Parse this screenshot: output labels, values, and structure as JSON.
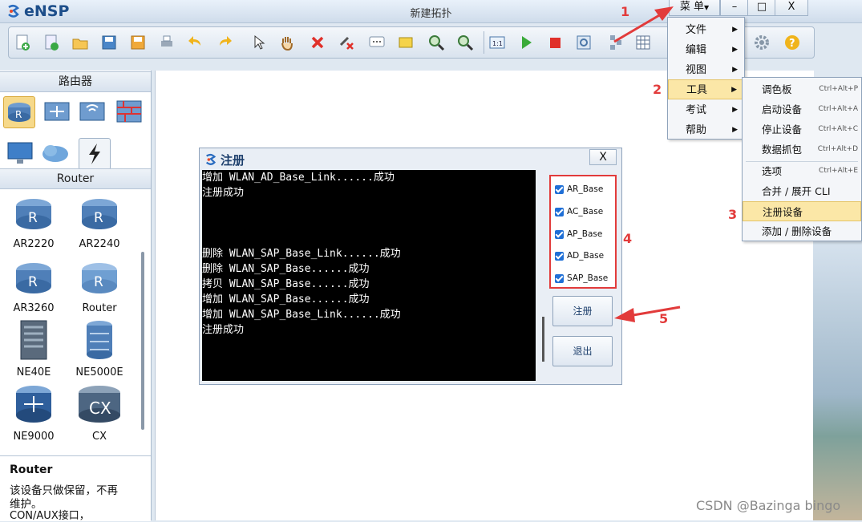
{
  "app": {
    "name": "eNSP",
    "title": "新建拓扑",
    "menu_label": "菜 单"
  },
  "window_buttons": {
    "minimize": "–",
    "maximize": "□",
    "close": "X"
  },
  "left_panel": {
    "category_title": "路由器",
    "device_title": "Router",
    "devices": [
      {
        "label": "AR2220"
      },
      {
        "label": "AR2240"
      },
      {
        "label": "AR3260"
      },
      {
        "label": "Router"
      },
      {
        "label": "NE40E"
      },
      {
        "label": "NE5000E"
      },
      {
        "label": "NE9000"
      },
      {
        "label": "CX"
      }
    ],
    "description": {
      "title": "Router",
      "line1": "该设备只做保留，不再",
      "line2": "维护。",
      "line3": "CON/AUX接口，"
    }
  },
  "dialog": {
    "title": "注册",
    "close": "X",
    "console_lines": [
      "增加 WLAN_AD_Base_Link......成功",
      "注册成功",
      "",
      "",
      "",
      "删除 WLAN_SAP_Base_Link......成功",
      "删除 WLAN_SAP_Base......成功",
      "拷贝 WLAN_SAP_Base......成功",
      "增加 WLAN_SAP_Base......成功",
      "增加 WLAN_SAP_Base_Link......成功",
      "注册成功"
    ],
    "checkboxes": [
      "AR_Base",
      "AC_Base",
      "AP_Base",
      "AD_Base",
      "SAP_Base"
    ],
    "register_button": "注册",
    "exit_button": "退出"
  },
  "main_menu": {
    "items": [
      {
        "label": "文件"
      },
      {
        "label": "编辑"
      },
      {
        "label": "视图"
      },
      {
        "label": "工具"
      },
      {
        "label": "考试"
      },
      {
        "label": "帮助"
      }
    ]
  },
  "tools_menu": {
    "items": [
      {
        "label": "调色板",
        "shortcut": "Ctrl+Alt+P"
      },
      {
        "label": "启动设备",
        "shortcut": "Ctrl+Alt+A"
      },
      {
        "label": "停止设备",
        "shortcut": "Ctrl+Alt+C"
      },
      {
        "label": "数据抓包",
        "shortcut": "Ctrl+Alt+D"
      },
      {
        "label": "选项",
        "shortcut": "Ctrl+Alt+E"
      },
      {
        "label": "合并 / 展开 CLI",
        "shortcut": ""
      },
      {
        "label": "注册设备",
        "shortcut": ""
      },
      {
        "label": "添加 / 删除设备",
        "shortcut": ""
      }
    ]
  },
  "annotations": [
    "1",
    "2",
    "3",
    "4",
    "5"
  ],
  "watermark": "CSDN @Bazinga bingo",
  "colors": {
    "highlight": "#fbe7a7",
    "annotation": "#e23b3b",
    "checkbox": "#1f6fd6"
  }
}
